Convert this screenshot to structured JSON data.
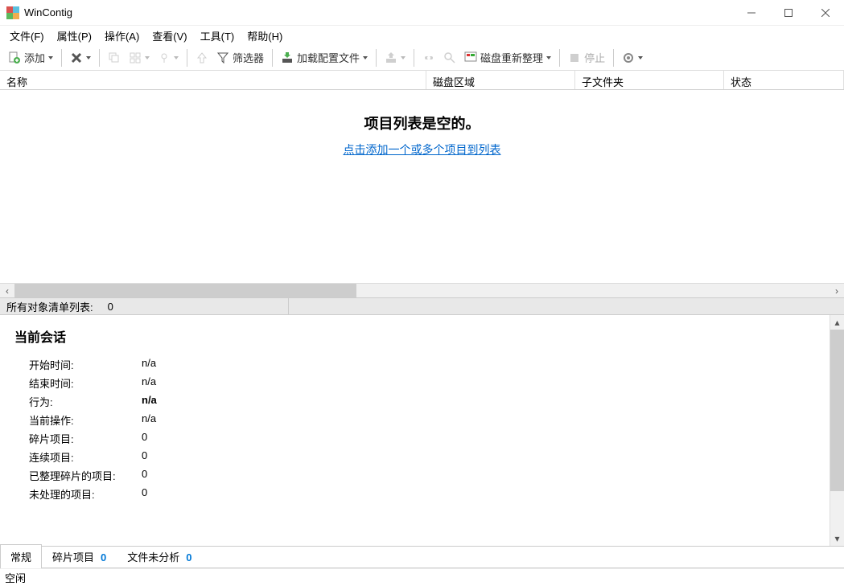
{
  "window": {
    "title": "WinContig"
  },
  "menu": {
    "file": "文件(F)",
    "profile": "属性(P)",
    "action": "操作(A)",
    "view": "查看(V)",
    "tools": "工具(T)",
    "help": "帮助(H)"
  },
  "toolbar": {
    "add": "添加",
    "filter": "筛选器",
    "load_profile": "加载配置文件",
    "disk_defrag": "磁盘重新整理",
    "stop": "停止"
  },
  "columns": {
    "name": "名称",
    "disk_area": "磁盘区域",
    "subfolders": "子文件夹",
    "status": "状态"
  },
  "empty": {
    "title": "项目列表是空的。",
    "link": "点击添加一个或多个项目到列表"
  },
  "countbar": {
    "label": "所有对象清单列表:",
    "value": "0"
  },
  "session": {
    "heading": "当前会话",
    "rows": [
      {
        "k": "开始时间:",
        "v": "n/a",
        "bold": false
      },
      {
        "k": "结束时间:",
        "v": "n/a",
        "bold": false
      },
      {
        "k": "行为:",
        "v": "n/a",
        "bold": true
      },
      {
        "k": "当前操作:",
        "v": "n/a",
        "bold": false
      },
      {
        "k": "碎片项目:",
        "v": "0",
        "bold": false
      },
      {
        "k": "连续项目:",
        "v": "0",
        "bold": false
      },
      {
        "k": "已整理碎片的项目:",
        "v": "0",
        "bold": false
      },
      {
        "k": "未处理的项目:",
        "v": "0",
        "bold": false
      }
    ]
  },
  "tabs": {
    "general": "常规",
    "frag_items": "碎片项目",
    "frag_items_count": "0",
    "not_analyzed": "文件未分析",
    "not_analyzed_count": "0"
  },
  "status": {
    "text": "空闲"
  }
}
